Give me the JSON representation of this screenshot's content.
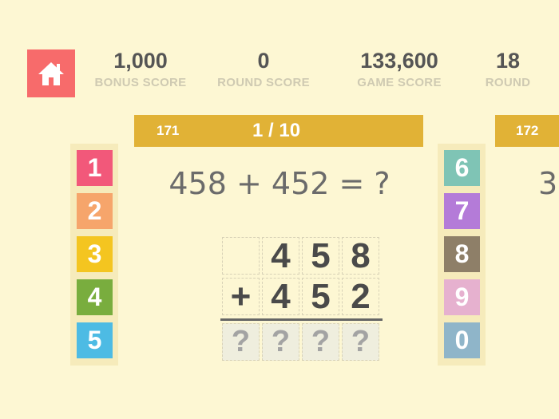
{
  "header": {
    "stats": {
      "bonus": {
        "value": "1,000",
        "label": "BONUS SCORE"
      },
      "round_score": {
        "value": "0",
        "label": "ROUND SCORE"
      },
      "game_score": {
        "value": "133,600",
        "label": "GAME SCORE"
      },
      "round": {
        "value": "18",
        "label": "ROUND"
      }
    }
  },
  "current_problem": {
    "number": "171",
    "progress": "1 / 10",
    "equation": "458 + 452 = ?",
    "rows": [
      [
        "",
        "4",
        "5",
        "8"
      ],
      [
        "+",
        "4",
        "5",
        "2"
      ]
    ],
    "answer": [
      "?",
      "?",
      "?",
      "?"
    ]
  },
  "next_problem": {
    "number": "172",
    "equation_peek": "3"
  },
  "keypad": {
    "left": [
      {
        "digit": "1",
        "color": "#f2587a"
      },
      {
        "digit": "2",
        "color": "#f6a56b"
      },
      {
        "digit": "3",
        "color": "#f4c520"
      },
      {
        "digit": "4",
        "color": "#79ad3e"
      },
      {
        "digit": "5",
        "color": "#4dbbe4"
      }
    ],
    "right": [
      {
        "digit": "6",
        "color": "#7fc4b5"
      },
      {
        "digit": "7",
        "color": "#b47bd8"
      },
      {
        "digit": "8",
        "color": "#8e7f68"
      },
      {
        "digit": "9",
        "color": "#e6b1cf"
      },
      {
        "digit": "0",
        "color": "#8fb5c9"
      }
    ]
  },
  "colors": {
    "home_button": "#f76b6b",
    "progress_bar": "#e1b236",
    "background": "#fdf7d3"
  },
  "icons": {
    "home": "home-icon"
  }
}
